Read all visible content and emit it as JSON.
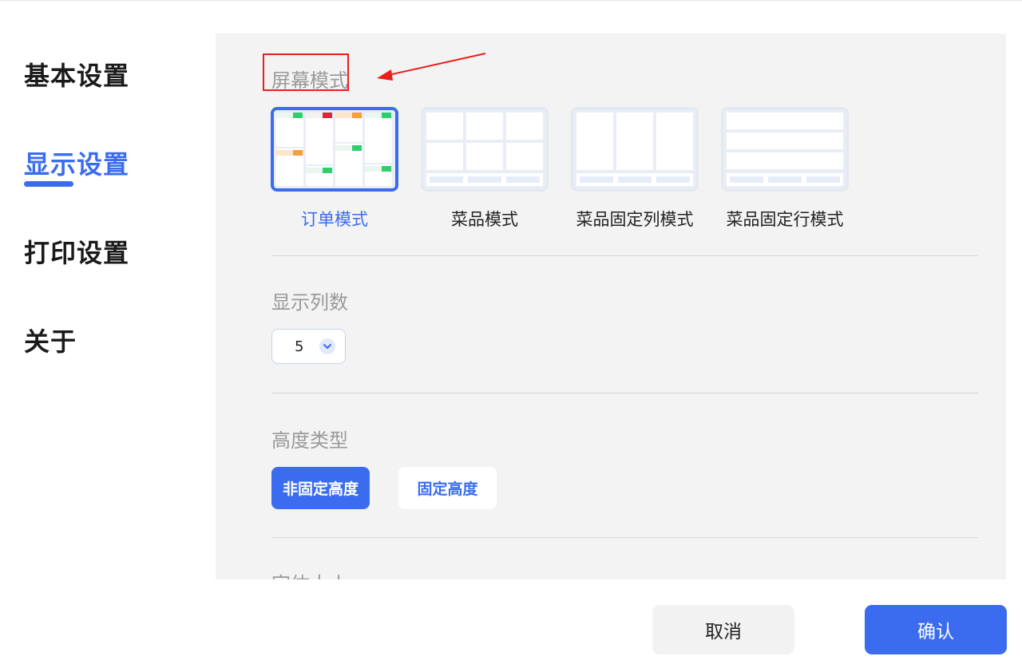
{
  "sidebar": {
    "items": [
      {
        "label": "基本设置",
        "active": false
      },
      {
        "label": "显示设置",
        "active": true
      },
      {
        "label": "打印设置",
        "active": false
      },
      {
        "label": "关于",
        "active": false
      }
    ]
  },
  "screen_mode": {
    "title": "屏幕模式",
    "options": [
      {
        "label": "订单模式",
        "selected": true
      },
      {
        "label": "菜品模式",
        "selected": false
      },
      {
        "label": "菜品固定列模式",
        "selected": false
      },
      {
        "label": "菜品固定行模式",
        "selected": false
      }
    ]
  },
  "columns": {
    "title": "显示列数",
    "value": "5"
  },
  "height_type": {
    "title": "高度类型",
    "options": [
      {
        "label": "非固定高度",
        "selected": true
      },
      {
        "label": "固定高度",
        "selected": false
      }
    ]
  },
  "font_size": {
    "title": "字体大小"
  },
  "footer": {
    "cancel_label": "取消",
    "confirm_label": "确认"
  },
  "colors": {
    "accent": "#3b6cf0",
    "annotation": "#e8201c",
    "tag_green": "#2fcf6f",
    "tag_orange": "#f6a03c",
    "tag_red": "#e8203c",
    "tag_peach": "#fde6c8"
  }
}
